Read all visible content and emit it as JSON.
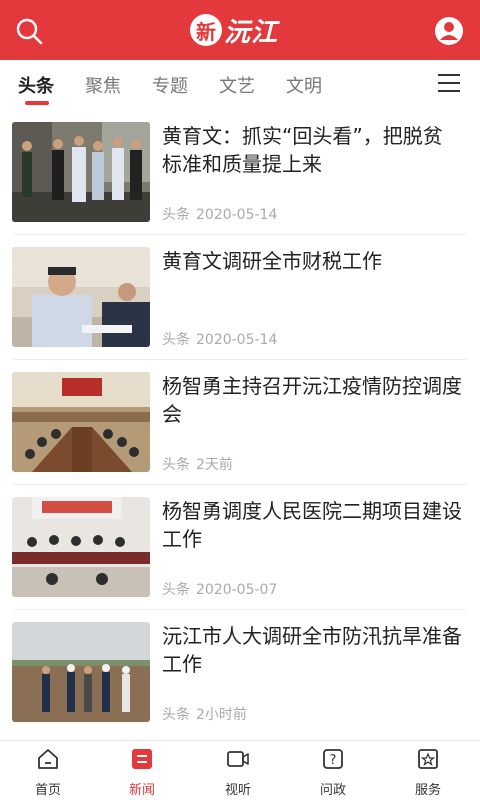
{
  "header": {
    "logo_mark": "新",
    "logo_text": "沅江"
  },
  "tabs": [
    {
      "label": "头条"
    },
    {
      "label": "聚焦"
    },
    {
      "label": "专题"
    },
    {
      "label": "文艺"
    },
    {
      "label": "文明"
    }
  ],
  "articles": [
    {
      "title": "黄育文：抓实“回头看”，把脱贫标准和质量提上来",
      "source": "头条",
      "date": "2020-05-14"
    },
    {
      "title": "黄育文调研全市财税工作",
      "source": "头条",
      "date": "2020-05-14"
    },
    {
      "title": "杨智勇主持召开沅江疫情防控调度会",
      "source": "头条",
      "date": "2天前"
    },
    {
      "title": "杨智勇调度人民医院二期项目建设工作",
      "source": "头条",
      "date": "2020-05-07"
    },
    {
      "title": "沅江市人大调研全市防汛抗旱准备工作",
      "source": "头条",
      "date": "2小时前"
    }
  ],
  "bottom_nav": [
    {
      "label": "首页",
      "icon": "home-icon"
    },
    {
      "label": "新闻",
      "icon": "news-icon"
    },
    {
      "label": "视听",
      "icon": "video-icon"
    },
    {
      "label": "问政",
      "icon": "question-icon"
    },
    {
      "label": "服务",
      "icon": "service-icon"
    }
  ],
  "colors": {
    "brand_red": "#e4393c",
    "muted_text": "#aaaaaa",
    "divider": "#ececec"
  }
}
